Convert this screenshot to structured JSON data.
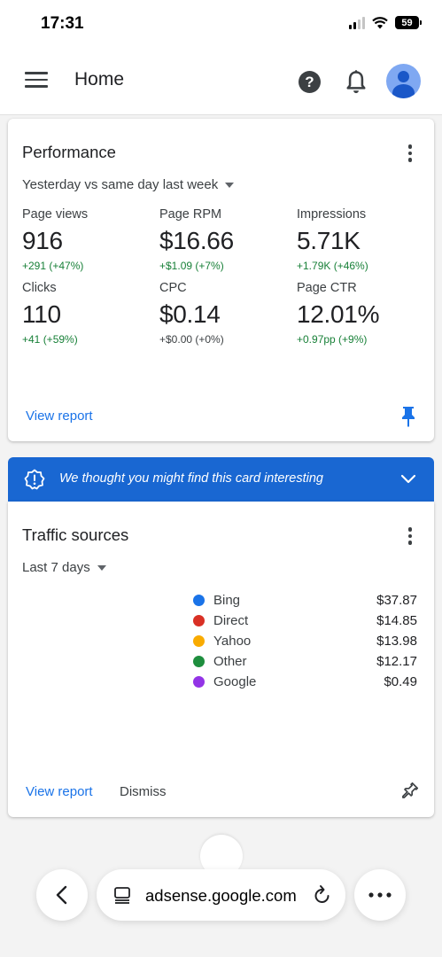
{
  "status_bar": {
    "time": "17:31",
    "battery": "59"
  },
  "header": {
    "title": "Home"
  },
  "performance": {
    "title": "Performance",
    "comparison": "Yesterday vs same day last week",
    "metrics": [
      {
        "label": "Page views",
        "value": "916",
        "change": "+291 (+47%)"
      },
      {
        "label": "Page RPM",
        "value": "$16.66",
        "change": "+$1.09 (+7%)"
      },
      {
        "label": "Impressions",
        "value": "5.71K",
        "change": "+1.79K (+46%)"
      },
      {
        "label": "Clicks",
        "value": "110",
        "change": "+41 (+59%)"
      },
      {
        "label": "CPC",
        "value": "$0.14",
        "change": "+$0.00 (+0%)"
      },
      {
        "label": "Page CTR",
        "value": "12.01%",
        "change": "+0.97pp (+9%)"
      }
    ],
    "view_report": "View report"
  },
  "banner": {
    "text": "We thought you might find this card interesting"
  },
  "traffic": {
    "title": "Traffic sources",
    "range": "Last 7 days",
    "sources": [
      {
        "name": "Bing",
        "value": "$37.87",
        "color": "#1a73e8"
      },
      {
        "name": "Direct",
        "value": "$14.85",
        "color": "#d93025"
      },
      {
        "name": "Yahoo",
        "value": "$13.98",
        "color": "#f9ab00"
      },
      {
        "name": "Other",
        "value": "$12.17",
        "color": "#1e8e3e"
      },
      {
        "name": "Google",
        "value": "$0.49",
        "color": "#9334e6"
      }
    ],
    "view_report": "View report",
    "dismiss": "Dismiss"
  },
  "browser": {
    "url": "adsense.google.com"
  },
  "colors": {
    "accent": "#1a73e8",
    "banner": "#1967d2",
    "positive": "#188038"
  }
}
